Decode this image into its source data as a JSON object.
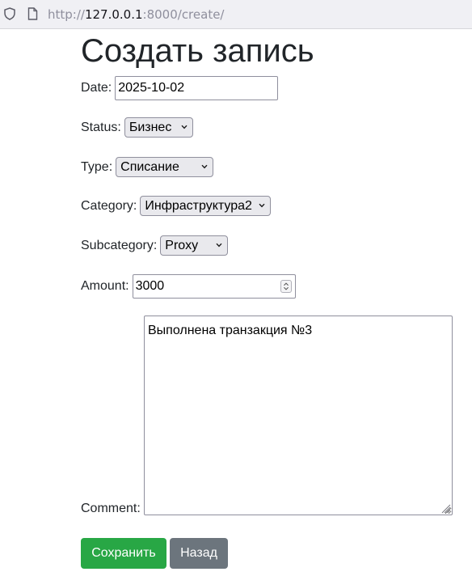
{
  "browser": {
    "url_prefix": "http://",
    "url_host": "127.0.0.1",
    "url_rest": ":8000/create/"
  },
  "page": {
    "title": "Создать запись"
  },
  "form": {
    "date": {
      "label": "Date:",
      "value": "2025-10-02"
    },
    "status": {
      "label": "Status:",
      "value": "Бизнес"
    },
    "type": {
      "label": "Type:",
      "value": "Списание"
    },
    "category": {
      "label": "Category:",
      "value": "Инфраструктура2"
    },
    "subcategory": {
      "label": "Subcategory:",
      "value": "Proxy"
    },
    "amount": {
      "label": "Amount:",
      "value": "3000"
    },
    "comment": {
      "label": "Comment:",
      "value": "Выполнена транзакция №3"
    }
  },
  "buttons": {
    "save": "Сохранить",
    "back": "Назад"
  },
  "colors": {
    "save_button": "#28a745",
    "back_button": "#6c757d"
  },
  "icons": {
    "shield": "shield-icon",
    "page": "page-icon",
    "select_arrow": "chevron-down-icon",
    "spinner": "number-spinner-icon",
    "resize": "resize-grip-icon"
  }
}
